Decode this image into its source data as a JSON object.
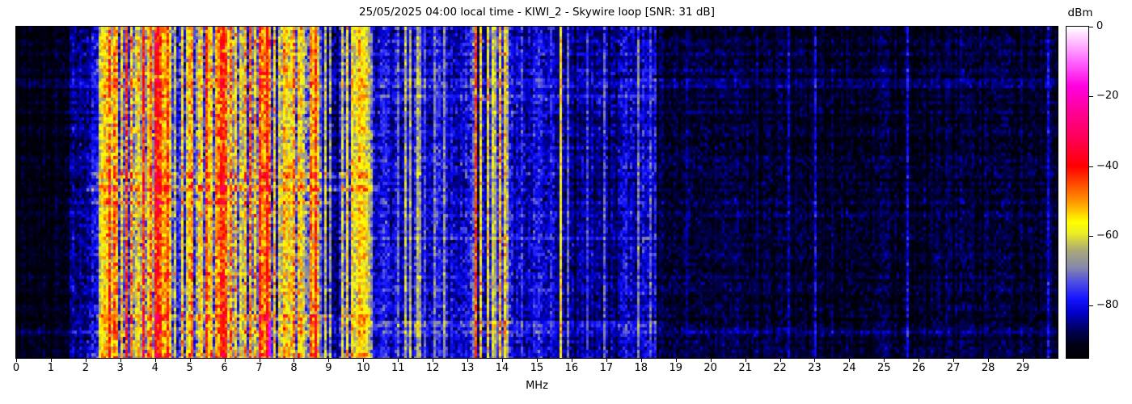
{
  "chart_data": {
    "type": "heatmap",
    "subtype": "spectrogram-waterfall",
    "title": "25/05/2025 04:00 local time - KIWI_2 - Skywire loop [SNR: 31 dB]",
    "xlabel": "MHz",
    "xlim": [
      0,
      30
    ],
    "x_ticks": [
      0,
      1,
      2,
      3,
      4,
      5,
      6,
      7,
      8,
      9,
      10,
      11,
      12,
      13,
      14,
      15,
      16,
      17,
      18,
      19,
      20,
      21,
      22,
      23,
      24,
      25,
      26,
      27,
      28,
      29
    ],
    "colorbar": {
      "label": "dBm",
      "range": [
        -95,
        0
      ],
      "ticks": [
        {
          "v": 0,
          "label": "0"
        },
        {
          "v": -20,
          "label": "−20"
        },
        {
          "v": -40,
          "label": "−40"
        },
        {
          "v": -60,
          "label": "−60"
        },
        {
          "v": -80,
          "label": "−80"
        }
      ]
    },
    "colormap": [
      {
        "v": -95,
        "c": "#000000"
      },
      {
        "v": -91,
        "c": "#000016"
      },
      {
        "v": -87,
        "c": "#000058"
      },
      {
        "v": -82,
        "c": "#0000c8"
      },
      {
        "v": -78,
        "c": "#1414ff"
      },
      {
        "v": -73,
        "c": "#5050e1"
      },
      {
        "v": -69,
        "c": "#8787ad"
      },
      {
        "v": -64,
        "c": "#aaaa77"
      },
      {
        "v": -59,
        "c": "#eeee22"
      },
      {
        "v": -56,
        "c": "#ffff00"
      },
      {
        "v": -50,
        "c": "#ff9500"
      },
      {
        "v": -44,
        "c": "#ff3c00"
      },
      {
        "v": -40,
        "c": "#ff0000"
      },
      {
        "v": -32,
        "c": "#ff0055"
      },
      {
        "v": -24,
        "c": "#ff0099"
      },
      {
        "v": -17,
        "c": "#ff00e1"
      },
      {
        "v": -10,
        "c": "#ff64ff"
      },
      {
        "v": -4,
        "c": "#ffc3ff"
      },
      {
        "v": 0,
        "c": "#ffffff"
      }
    ],
    "bands": [
      {
        "f0": 0.0,
        "f1": 1.55,
        "base": -91.5,
        "jitter": 1.2,
        "tnoise": 2.0,
        "activity": 0.0,
        "sigLo": -88,
        "sigHi": -84
      },
      {
        "f0": 1.55,
        "f1": 2.05,
        "base": -85.0,
        "jitter": 2.0,
        "tnoise": 3.0,
        "activity": 0.05,
        "sigLo": -76,
        "sigHi": -66
      },
      {
        "f0": 2.05,
        "f1": 2.55,
        "base": -81.0,
        "jitter": 3.0,
        "tnoise": 3.5,
        "activity": 0.12,
        "sigLo": -70,
        "sigHi": -55
      },
      {
        "f0": 2.55,
        "f1": 4.55,
        "base": -73.0,
        "jitter": 5.0,
        "tnoise": 5.0,
        "activity": 0.45,
        "sigLo": -68,
        "sigHi": -42
      },
      {
        "f0": 4.55,
        "f1": 5.15,
        "base": -77.0,
        "jitter": 4.0,
        "tnoise": 4.5,
        "activity": 0.3,
        "sigLo": -68,
        "sigHi": -50
      },
      {
        "f0": 5.15,
        "f1": 8.75,
        "base": -73.0,
        "jitter": 5.0,
        "tnoise": 5.0,
        "activity": 0.48,
        "sigLo": -68,
        "sigHi": -42
      },
      {
        "f0": 8.75,
        "f1": 9.35,
        "base": -81.0,
        "jitter": 3.0,
        "tnoise": 4.0,
        "activity": 0.1,
        "sigLo": -72,
        "sigHi": -60
      },
      {
        "f0": 9.35,
        "f1": 10.25,
        "base": -79.0,
        "jitter": 3.5,
        "tnoise": 4.0,
        "activity": 0.25,
        "sigLo": -70,
        "sigHi": -55
      },
      {
        "f0": 10.25,
        "f1": 13.05,
        "base": -80.5,
        "jitter": 2.5,
        "tnoise": 3.5,
        "activity": 0.08,
        "sigLo": -75,
        "sigHi": -62
      },
      {
        "f0": 13.05,
        "f1": 14.3,
        "base": -79.5,
        "jitter": 3.0,
        "tnoise": 4.0,
        "activity": 0.2,
        "sigLo": -72,
        "sigHi": -55
      },
      {
        "f0": 14.3,
        "f1": 15.55,
        "base": -82.0,
        "jitter": 2.5,
        "tnoise": 3.5,
        "activity": 0.05,
        "sigLo": -76,
        "sigHi": -68
      },
      {
        "f0": 15.55,
        "f1": 16.1,
        "base": -84.0,
        "jitter": 2.0,
        "tnoise": 3.0,
        "activity": 0.05,
        "sigLo": -78,
        "sigHi": -70
      },
      {
        "f0": 16.1,
        "f1": 17.35,
        "base": -85.5,
        "jitter": 2.0,
        "tnoise": 3.0,
        "activity": 0.07,
        "sigLo": -80,
        "sigHi": -72
      },
      {
        "f0": 17.35,
        "f1": 18.45,
        "base": -83.0,
        "jitter": 2.5,
        "tnoise": 3.5,
        "activity": 0.1,
        "sigLo": -78,
        "sigHi": -70
      },
      {
        "f0": 18.45,
        "f1": 30.0,
        "base": -89.5,
        "jitter": 1.5,
        "tnoise": 2.5,
        "activity": 0.02,
        "sigLo": -84,
        "sigHi": -78
      }
    ],
    "signals": [
      {
        "f": 2.38,
        "db": -62
      },
      {
        "f": 2.49,
        "db": -57
      },
      {
        "f": 2.62,
        "db": -55
      },
      {
        "f": 2.76,
        "db": -60
      },
      {
        "f": 2.88,
        "db": -52
      },
      {
        "f": 3.01,
        "db": -57
      },
      {
        "f": 3.2,
        "db": -45
      },
      {
        "f": 3.33,
        "db": -50
      },
      {
        "f": 3.48,
        "db": -60
      },
      {
        "f": 3.68,
        "db": -42
      },
      {
        "f": 3.81,
        "db": -55
      },
      {
        "f": 3.91,
        "db": -47
      },
      {
        "f": 4.03,
        "db": -40,
        "w": 0.06
      },
      {
        "f": 4.18,
        "db": -44
      },
      {
        "f": 4.33,
        "db": -52
      },
      {
        "f": 4.47,
        "db": -57
      },
      {
        "f": 4.61,
        "db": -62
      },
      {
        "f": 4.77,
        "db": -55
      },
      {
        "f": 4.91,
        "db": -60
      },
      {
        "f": 5.06,
        "db": -50
      },
      {
        "f": 5.31,
        "db": -57
      },
      {
        "f": 5.5,
        "db": -44
      },
      {
        "f": 5.63,
        "db": -55
      },
      {
        "f": 5.8,
        "db": -50
      },
      {
        "f": 5.96,
        "db": -42,
        "w": 0.06
      },
      {
        "f": 6.07,
        "db": -46
      },
      {
        "f": 6.19,
        "db": -50
      },
      {
        "f": 6.31,
        "db": -55
      },
      {
        "f": 6.45,
        "db": -60
      },
      {
        "f": 6.6,
        "db": -52
      },
      {
        "f": 6.76,
        "db": -48
      },
      {
        "f": 6.91,
        "db": -55
      },
      {
        "f": 6.99,
        "db": -42
      },
      {
        "f": 7.13,
        "db": -50
      },
      {
        "f": 7.22,
        "db": -40
      },
      {
        "f": 7.31,
        "db": -48
      },
      {
        "f": 7.43,
        "db": -55
      },
      {
        "f": 7.56,
        "db": -60
      },
      {
        "f": 7.71,
        "db": -52
      },
      {
        "f": 7.86,
        "db": -57
      },
      {
        "f": 8.0,
        "db": -50
      },
      {
        "f": 8.12,
        "db": -55
      },
      {
        "f": 8.29,
        "db": -60
      },
      {
        "f": 8.46,
        "db": -48
      },
      {
        "f": 8.59,
        "db": -55
      },
      {
        "f": 9.06,
        "db": -67
      },
      {
        "f": 9.41,
        "db": -62
      },
      {
        "f": 9.56,
        "db": -57
      },
      {
        "f": 9.66,
        "db": -55
      },
      {
        "f": 9.91,
        "db": -52
      },
      {
        "f": 10.01,
        "db": -55
      },
      {
        "f": 10.16,
        "db": -64
      },
      {
        "f": 11.01,
        "db": -72
      },
      {
        "f": 11.61,
        "db": -67
      },
      {
        "f": 12.06,
        "db": -70
      },
      {
        "f": 12.31,
        "db": -68
      },
      {
        "f": 13.21,
        "db": -45
      },
      {
        "f": 13.56,
        "db": -57
      },
      {
        "f": 13.79,
        "db": -64
      },
      {
        "f": 13.96,
        "db": -52
      },
      {
        "f": 14.06,
        "db": -55
      },
      {
        "f": 15.72,
        "db": -56
      },
      {
        "f": 16.46,
        "db": -76
      },
      {
        "f": 16.96,
        "db": -73
      },
      {
        "f": 17.56,
        "db": -78
      },
      {
        "f": 17.91,
        "db": -69
      },
      {
        "f": 7.27,
        "db": -17,
        "y0": 0.88,
        "y1": 0.99
      }
    ],
    "row_events": [
      {
        "y0": 0.155,
        "y1": 0.175,
        "f0": 0.0,
        "f1": 30.0,
        "db": 2.5
      },
      {
        "y0": 0.2,
        "y1": 0.215,
        "f0": 8.6,
        "f1": 18.5,
        "db": 4.0
      },
      {
        "y0": 0.35,
        "y1": 0.365,
        "f0": 8.6,
        "f1": 18.5,
        "db": 3.5
      },
      {
        "y0": 0.435,
        "y1": 0.455,
        "f0": 2.2,
        "f1": 10.3,
        "db": 7.0
      },
      {
        "y0": 0.47,
        "y1": 0.49,
        "f0": 2.0,
        "f1": 10.5,
        "db": 9.0
      },
      {
        "y0": 0.515,
        "y1": 0.53,
        "f0": 2.2,
        "f1": 9.0,
        "db": 6.0
      },
      {
        "y0": 0.55,
        "y1": 0.565,
        "f0": 0.0,
        "f1": 30.0,
        "db": 2.0
      },
      {
        "y0": 0.625,
        "y1": 0.64,
        "f0": 8.6,
        "f1": 18.5,
        "db": 4.0
      },
      {
        "y0": 0.73,
        "y1": 0.745,
        "f0": 2.5,
        "f1": 9.5,
        "db": 5.0
      },
      {
        "y0": 0.862,
        "y1": 0.882,
        "f0": 2.3,
        "f1": 10.2,
        "db": 9.0
      },
      {
        "y0": 0.882,
        "y1": 0.9,
        "f0": 8.0,
        "f1": 18.5,
        "db": 6.0
      },
      {
        "y0": 0.905,
        "y1": 0.92,
        "f0": 0.0,
        "f1": 30.0,
        "db": 3.5
      },
      {
        "y0": 0.975,
        "y1": 1.0,
        "f0": 2.0,
        "f1": 10.3,
        "db": 5.0
      }
    ]
  }
}
